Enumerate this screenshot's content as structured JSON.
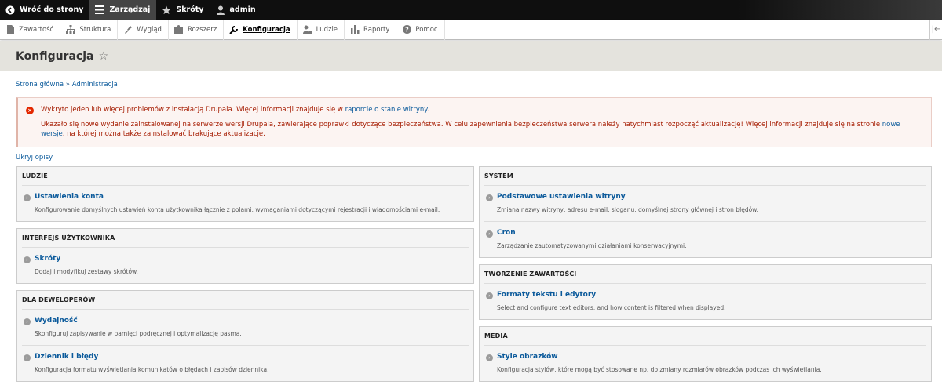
{
  "toolbar": {
    "items": [
      {
        "label": "Wróć do strony",
        "icon": "back-circle-icon"
      },
      {
        "label": "Zarządzaj",
        "icon": "menu-icon"
      },
      {
        "label": "Skróty",
        "icon": "star-icon"
      },
      {
        "label": "admin",
        "icon": "user-icon"
      }
    ]
  },
  "tray": {
    "items": [
      {
        "label": "Zawartość",
        "icon": "file-icon"
      },
      {
        "label": "Struktura",
        "icon": "sitemap-icon"
      },
      {
        "label": "Wygląd",
        "icon": "paint-icon"
      },
      {
        "label": "Rozszerz",
        "icon": "puzzle-icon"
      },
      {
        "label": "Konfiguracja",
        "icon": "wrench-icon"
      },
      {
        "label": "Ludzie",
        "icon": "people-icon"
      },
      {
        "label": "Raporty",
        "icon": "bar-chart-icon"
      },
      {
        "label": "Pomoc",
        "icon": "help-icon"
      }
    ],
    "toggle": "|←"
  },
  "page": {
    "title": "Konfiguracja",
    "star": "☆"
  },
  "breadcrumb": {
    "home": "Strona główna",
    "sep": " » ",
    "admin": "Administracja"
  },
  "messages": {
    "line1_pre": "Wykryto jeden lub więcej problemów z instalacją Drupala. Więcej informacji znajduje się w ",
    "line1_link": "raporcie o stanie witryny",
    "line1_post": ".",
    "line2_pre": "Ukazało się nowe wydanie zainstalowanej na serwerze wersji Drupala, zawierające poprawki dotyczące bezpieczeństwa. W celu zapewnienia bezpieczeństwa serwera należy natychmiast rozpocząć aktualizację! Więcej informacji znajduje się na stronie ",
    "line2_link": "nowe wersje",
    "line2_post": ", na której można także zainstalować brakujące aktualizacje."
  },
  "hide_descriptions": "Ukryj opisy",
  "left": {
    "ludzie": {
      "title": "LUDZIE",
      "items": [
        {
          "label": "Ustawienia konta",
          "desc": "Konfigurowanie domyślnych ustawień konta użytkownika łącznie z polami, wymaganiami dotyczącymi rejestracji i wiadomościami e-mail."
        }
      ]
    },
    "interfejs": {
      "title": "INTERFEJS UŻYTKOWNIKA",
      "items": [
        {
          "label": "Skróty",
          "desc": "Dodaj i modyfikuj zestawy skrótów."
        }
      ]
    },
    "dev": {
      "title": "DLA DEWELOPERÓW",
      "items": [
        {
          "label": "Wydajność",
          "desc": "Skonfiguruj zapisywanie w pamięci podręcznej i optymalizację pasma."
        },
        {
          "label": "Dziennik i błędy",
          "desc": "Konfiguracja formatu wyświetlania komunikatów o błędach i zapisów dziennika."
        }
      ]
    }
  },
  "right": {
    "system": {
      "title": "SYSTEM",
      "items": [
        {
          "label": "Podstawowe ustawienia witryny",
          "desc": "Zmiana nazwy witryny, adresu e-mail, sloganu, domyślnej strony głównej i stron błędów."
        },
        {
          "label": "Cron",
          "desc": "Zarządzanie zautomatyzowanymi działaniami konserwacyjnymi."
        }
      ]
    },
    "tworzenie": {
      "title": "TWORZENIE ZAWARTOŚCI",
      "items": [
        {
          "label": "Formaty tekstu i edytory",
          "desc": "Select and configure text editors, and how content is filtered when displayed."
        }
      ]
    },
    "media": {
      "title": "MEDIA",
      "items": [
        {
          "label": "Style obrazków",
          "desc": "Konfiguracja stylów, które mogą być stosowane np. do zmiany rozmiarów obrazków podczas ich wyświetlania."
        }
      ]
    }
  }
}
